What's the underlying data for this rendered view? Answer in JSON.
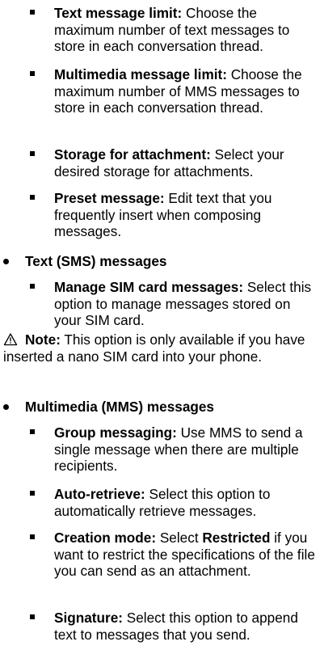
{
  "sections": {
    "storage_items": [
      {
        "term": "Text message limit:",
        "desc": " Choose the maximum number of text messages to store in each conversation thread."
      },
      {
        "term": "Multimedia message limit:",
        "desc": " Choose the maximum number of MMS messages to store in each conversation thread."
      },
      {
        "term": "Storage for attachment:",
        "desc": " Select your desired storage for attachments."
      },
      {
        "term": "Preset message:",
        "desc": " Edit text that you frequently insert when composing messages."
      }
    ],
    "sms": {
      "heading": "Text (SMS) messages",
      "items": [
        {
          "term": "Manage SIM card messages:",
          "desc": " Select this option to manage messages stored on your SIM card."
        }
      ]
    },
    "note": {
      "label": "Note:",
      "text": " This option is only available if you have inserted a nano SIM card into your phone."
    },
    "mms": {
      "heading": "Multimedia (MMS) messages",
      "items": [
        {
          "term": "Group messaging:",
          "desc": " Use MMS to send a single message when there are multiple recipients."
        },
        {
          "term": "Auto-retrieve:",
          "desc": " Select this option to automatically retrieve messages."
        },
        {
          "term": "Creation mode:",
          "desc_a": " Select ",
          "emph": "Restricted",
          "desc_b": " if you want to restrict the specifications of the file you can send as an attachment."
        },
        {
          "term": "Signature:",
          "desc": " Select this option to append text to messages that you send."
        }
      ]
    }
  },
  "icons": {
    "note": "warning-triangle-icon",
    "top_bullet": "round-bullet-icon",
    "sub_bullet": "square-bullet-icon"
  }
}
